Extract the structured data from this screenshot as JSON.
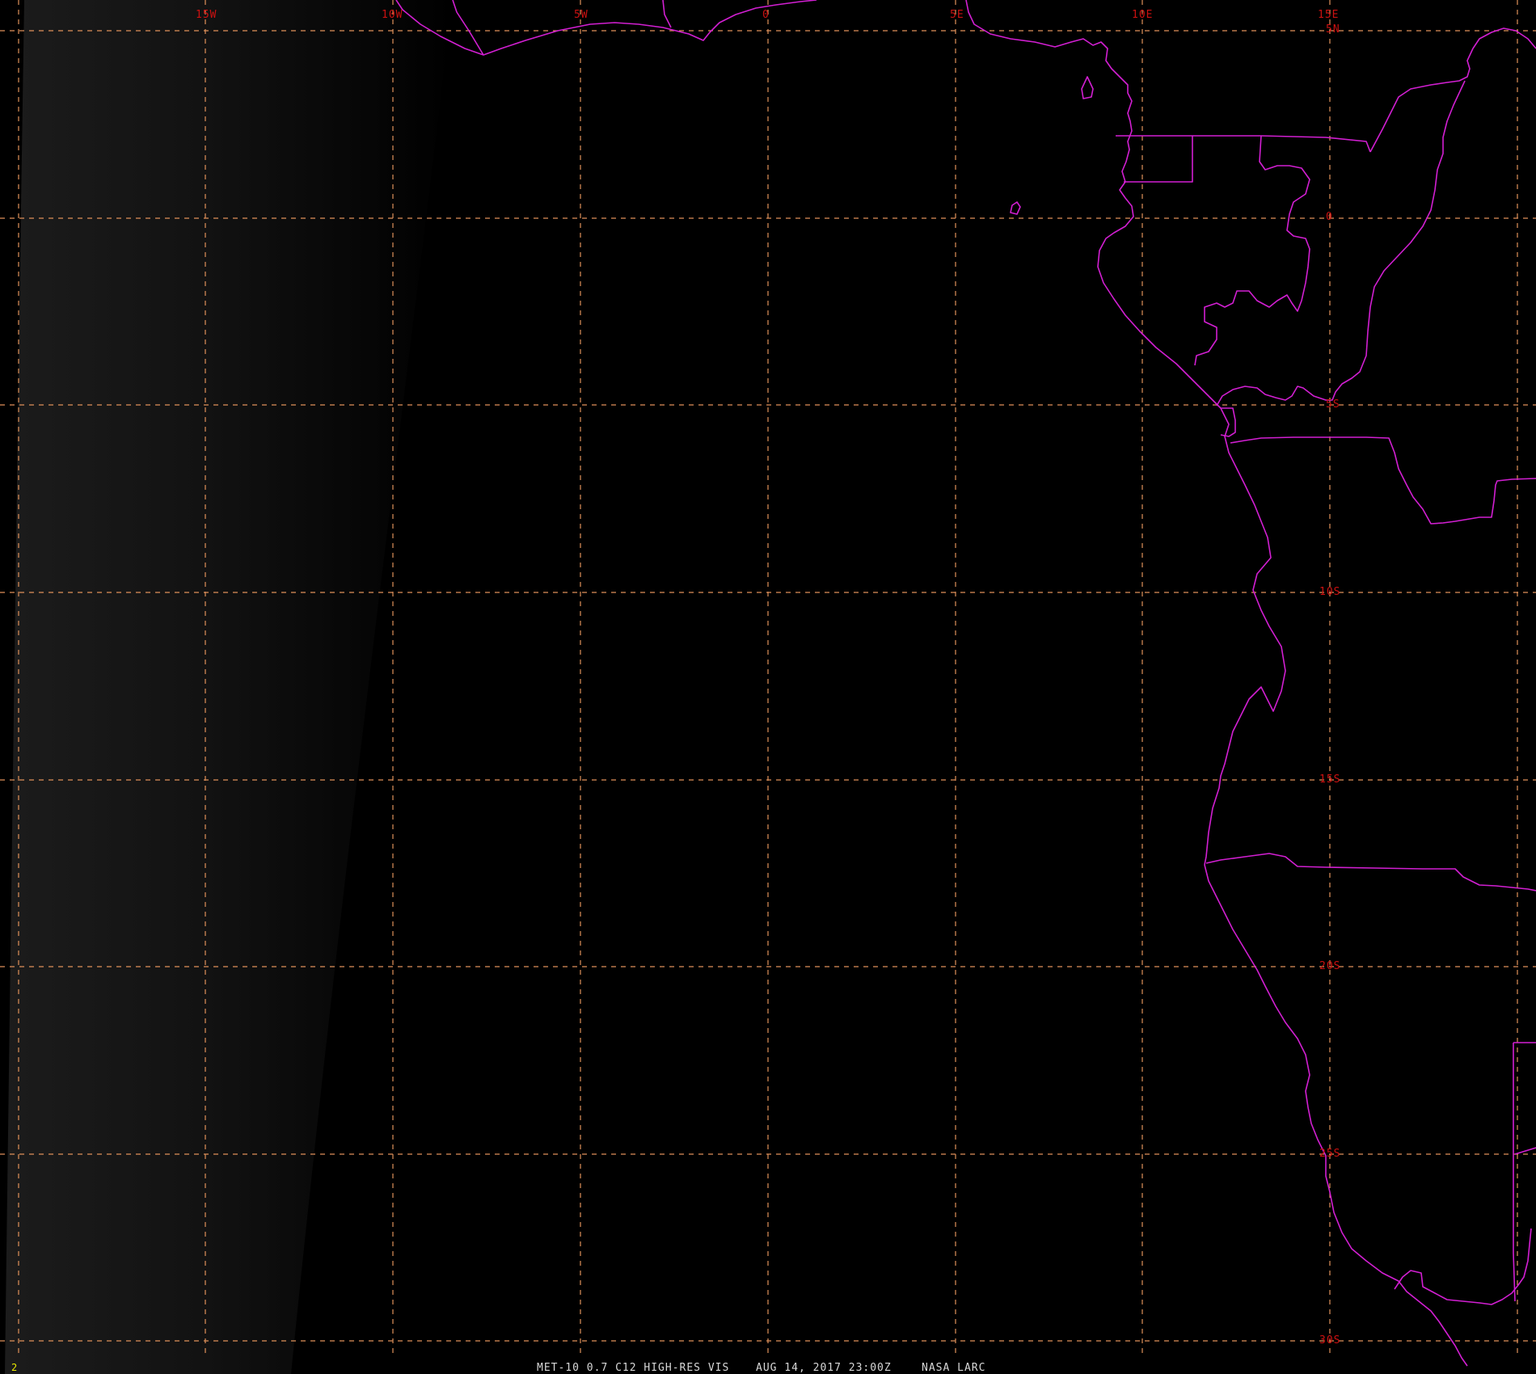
{
  "map": {
    "longitude_labels": [
      "15W",
      "10W",
      "5W",
      "0",
      "5E",
      "10E",
      "15E"
    ],
    "latitude_labels": [
      "5N",
      "0",
      "5S",
      "10S",
      "15S",
      "20S",
      "25S",
      "30S"
    ],
    "colors": {
      "background": "#000000",
      "graticule": "#e0915a",
      "borders": "#d21fd2",
      "labels": "#cc1111",
      "caption": "#d8d8d8",
      "frame_number": "#e8e800"
    }
  },
  "caption": {
    "frame_number": "2",
    "product": "MET-10 0.7 C12 HIGH-RES VIS",
    "datetime": "AUG 14, 2017 23:00Z",
    "source": "NASA LARC"
  }
}
